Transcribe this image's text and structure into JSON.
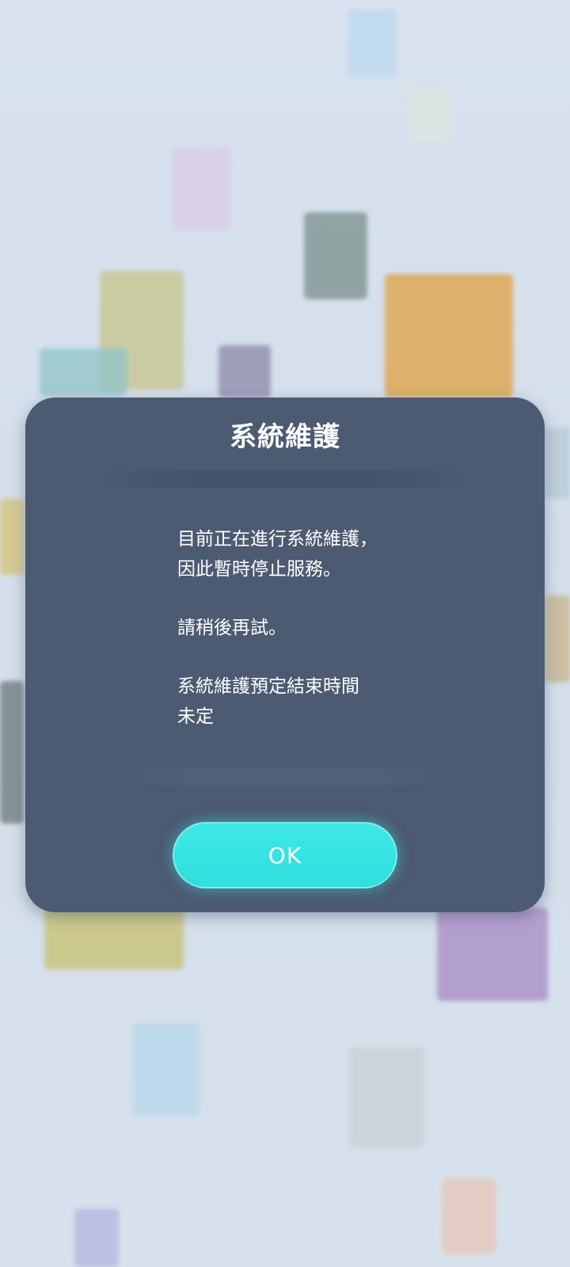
{
  "dialog": {
    "title": "系統維護",
    "message_lines": [
      "目前正在進行系統維護，",
      "因此暫時停止服務。",
      "請稍後再試。",
      "系統維護預定結束時間",
      "未定"
    ],
    "ok_label": "OK"
  },
  "colors": {
    "background": "#d6e1ec",
    "dialog_bg": "#4c5a72",
    "button_accent": "#33e2df",
    "text": "#ffffff"
  }
}
